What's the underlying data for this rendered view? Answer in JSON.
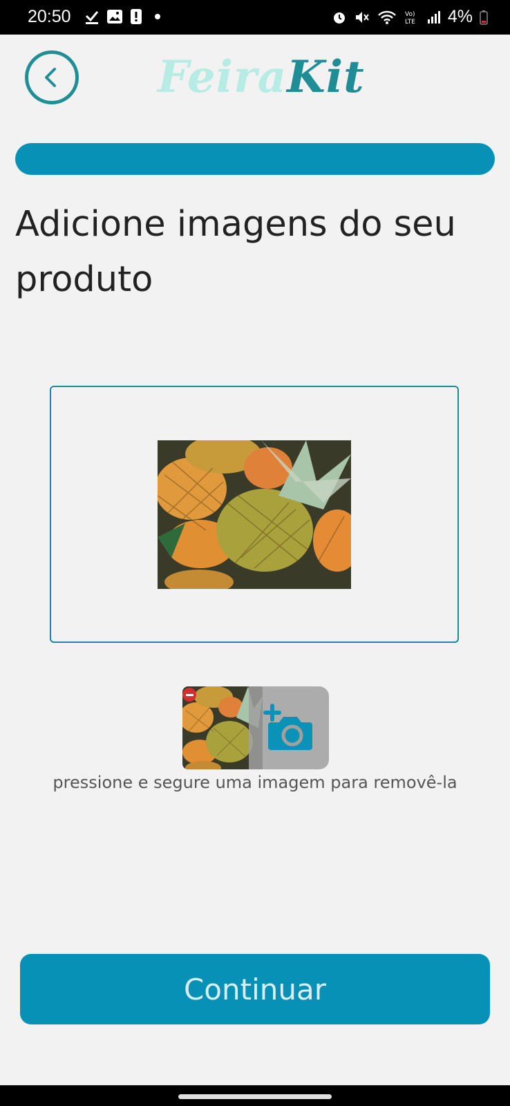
{
  "status_bar": {
    "time": "20:50",
    "battery": "4%",
    "icons_left": [
      "download-done-icon",
      "image-icon",
      "alert-icon",
      "dot-icon"
    ],
    "icons_right": [
      "alarm-icon",
      "mute-icon",
      "wifi-icon",
      "volte-icon",
      "signal-icon",
      "battery-low-icon"
    ]
  },
  "header": {
    "back_icon": "chevron-left-icon",
    "logo_part1": "Feira",
    "logo_part2": "Kit"
  },
  "progress": {
    "fraction": 1.0,
    "color": "#0791b6"
  },
  "title": "Adicione imagens do seu produto",
  "preview": {
    "image": "pineapples-photo"
  },
  "thumbnails": [
    {
      "image": "pineapples-photo",
      "remove_icon": "remove-badge-icon"
    }
  ],
  "add_photo_icon": "add-camera-icon",
  "hint": "pressione e segure uma imagem para removê-la",
  "continue_label": "Continuar",
  "colors": {
    "accent": "#0791b6",
    "logo_light": "#b6ece4",
    "logo_dark": "#1e8d95",
    "remove": "#d32f2f"
  }
}
